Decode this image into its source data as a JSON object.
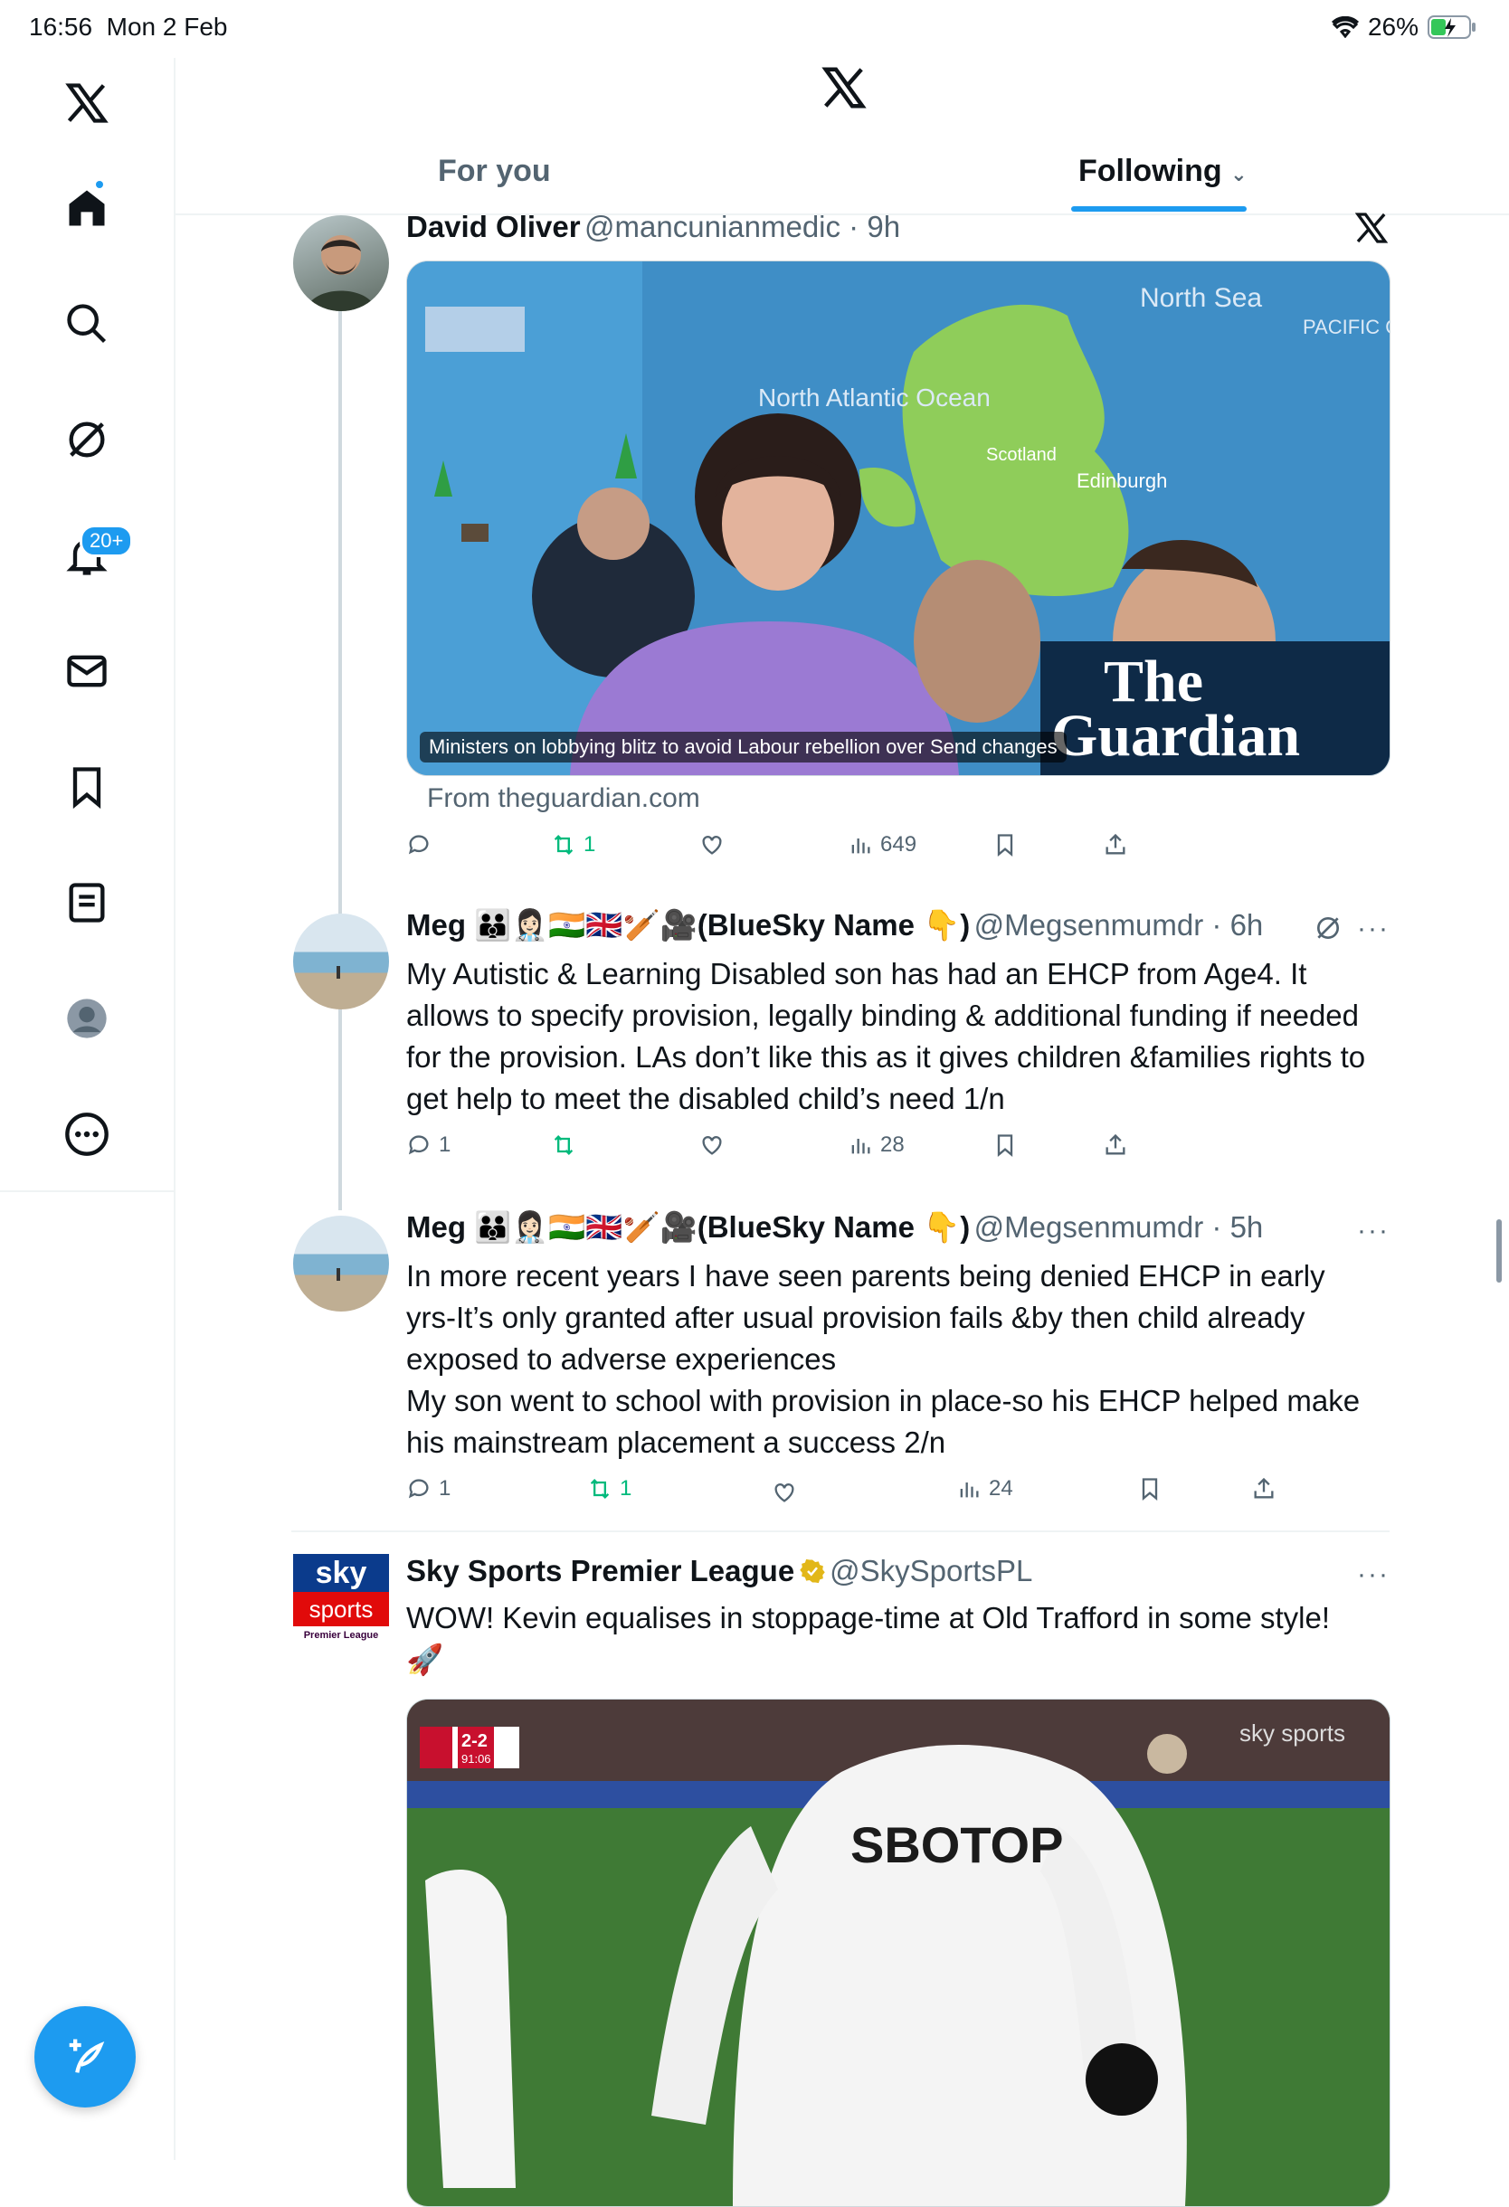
{
  "status": {
    "time": "16:56",
    "date": "Mon 2 Feb",
    "battery": "26%"
  },
  "sidebar": {
    "notifications_badge": "20+",
    "items": [
      "home-icon",
      "search-icon",
      "grok-icon",
      "notifications-icon",
      "messages-icon",
      "bookmarks-icon",
      "lists-icon",
      "profile-icon",
      "more-icon"
    ]
  },
  "header": {
    "tabs": [
      {
        "label": "For you"
      },
      {
        "label": "Following"
      }
    ]
  },
  "posts": [
    {
      "name": "David Oliver",
      "handle": "@mancunianmedic · 9h",
      "card_caption": "Ministers on lobbying blitz to avoid Labour rebellion over Send changes",
      "card_source": "From theguardian.com",
      "card_brand_line1": "The",
      "card_brand_line2": "Guardian",
      "map_labels": [
        "North Sea",
        "North Atlantic Ocean",
        "Scotland",
        "Edinburgh",
        "PACIFIC OCEAN"
      ],
      "replies": "",
      "reposts": "1",
      "likes": "",
      "views": "649"
    },
    {
      "name": "Meg 👪👩🏻‍⚕️🇮🇳🇬🇧🏏🎥(BlueSky Name 👇)",
      "handle": "@Megsenmumdr · 6h",
      "text": "My Autistic & Learning Disabled son has had an EHCP from Age4. It allows to specify provision, legally binding & additional funding if needed for the provision. LAs don’t like this as it gives children &families rights to get help to meet the disabled child’s need 1/n",
      "replies": "1",
      "reposts": "",
      "likes": "",
      "views": "28"
    },
    {
      "name": "Meg 👪👩🏻‍⚕️🇮🇳🇬🇧🏏🎥(BlueSky Name 👇)",
      "handle": "@Megsenmumdr · 5h",
      "text_lines": [
        "In more recent years I have seen parents being denied EHCP in early yrs-It’s only granted after usual provision fails &by then child already exposed to adverse experiences",
        "My son went to school with provision in place-so his EHCP helped make his mainstream placement a success 2/n"
      ],
      "replies": "1",
      "reposts": "1",
      "likes": "",
      "views": "24"
    },
    {
      "name": "Sky Sports Premier League",
      "handle": "@SkySportsPL",
      "text": "WOW! Kevin equalises in stoppage-time at Old Trafford in some style! 🚀",
      "avatar_text_1": "sky",
      "avatar_text_2": "sports",
      "avatar_text_3": "Premier League",
      "video_score": "2-2",
      "video_clock": "91:06",
      "video_watermark": "sky sports",
      "shirt_text": "SBOTOP"
    }
  ],
  "colors": {
    "accent": "#1d9bf0",
    "repost": "#00ba7c",
    "muted": "#536471"
  }
}
